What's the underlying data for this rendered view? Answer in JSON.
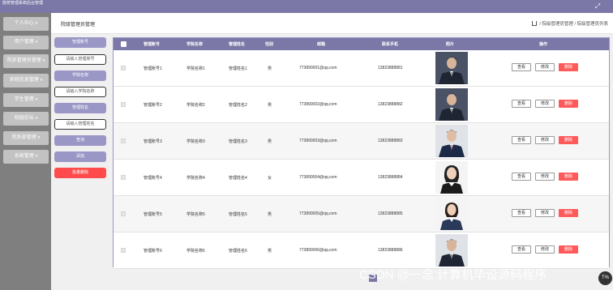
{
  "app": {
    "title": "院校管理系统后台管理",
    "expand_icon": "expand-icon"
  },
  "sidebar": {
    "items": [
      {
        "label": "个人中心"
      },
      {
        "label": "用户管理"
      },
      {
        "label": "院系管理员管理"
      },
      {
        "label": "系统信息管理"
      },
      {
        "label": "学生管理"
      },
      {
        "label": "校园论坛"
      },
      {
        "label": "院系部管理"
      },
      {
        "label": "系统管理"
      }
    ]
  },
  "header": {
    "page_title": "院级管理员管理",
    "breadcrumb": [
      "院级管理员管理",
      "院级管理员列表"
    ]
  },
  "filters": {
    "account_label": "管理账号",
    "account_placeholder": "请输入管理账号",
    "college_label": "学院名称",
    "college_placeholder": "请输入学院名称",
    "name_label": "管理姓名",
    "name_placeholder": "请输入管理姓名",
    "search_label": "查询",
    "add_label": "添加",
    "batch_delete_label": "批量删除"
  },
  "table": {
    "headers": [
      "管理账号",
      "学院名称",
      "管理姓名",
      "性别",
      "邮箱",
      "联系手机",
      "照片",
      "操作"
    ],
    "rows": [
      {
        "account": "管理账号1",
        "college": "学院名称1",
        "name": "管理姓名1",
        "gender": "男",
        "email": "773890001@qq.com",
        "phone": "13823888881",
        "photo": "male-suit"
      },
      {
        "account": "管理账号2",
        "college": "学院名称2",
        "name": "管理姓名2",
        "gender": "男",
        "email": "773890002@qq.com",
        "phone": "13823888882",
        "photo": "male-suit"
      },
      {
        "account": "管理账号3",
        "college": "学院名称3",
        "name": "管理姓名3",
        "gender": "男",
        "email": "773890003@qq.com",
        "phone": "13823888883",
        "photo": "male-suit-light"
      },
      {
        "account": "管理账号4",
        "college": "学院名称4",
        "name": "管理姓名4",
        "gender": "女",
        "email": "773890004@qq.com",
        "phone": "13823888884",
        "photo": "female"
      },
      {
        "account": "管理账号5",
        "college": "学院名称5",
        "name": "管理姓名5",
        "gender": "男",
        "email": "773890005@qq.com",
        "phone": "13823888885",
        "photo": "female"
      },
      {
        "account": "管理账号6",
        "college": "学院名称6",
        "name": "管理姓名6",
        "gender": "男",
        "email": "773890006@qq.com",
        "phone": "13823888886",
        "photo": "male-suit"
      }
    ],
    "view_label": "查看",
    "edit_label": "修改",
    "delete_label": "删除"
  },
  "watermark": "CSDN @一念 计算机毕设源码程序",
  "scroll_top_label": "T%",
  "colors": {
    "accent": "#7b77a6",
    "accent_light": "#9a97c6",
    "danger": "#ff4b4b",
    "sidebar": "#7f7f7f"
  }
}
